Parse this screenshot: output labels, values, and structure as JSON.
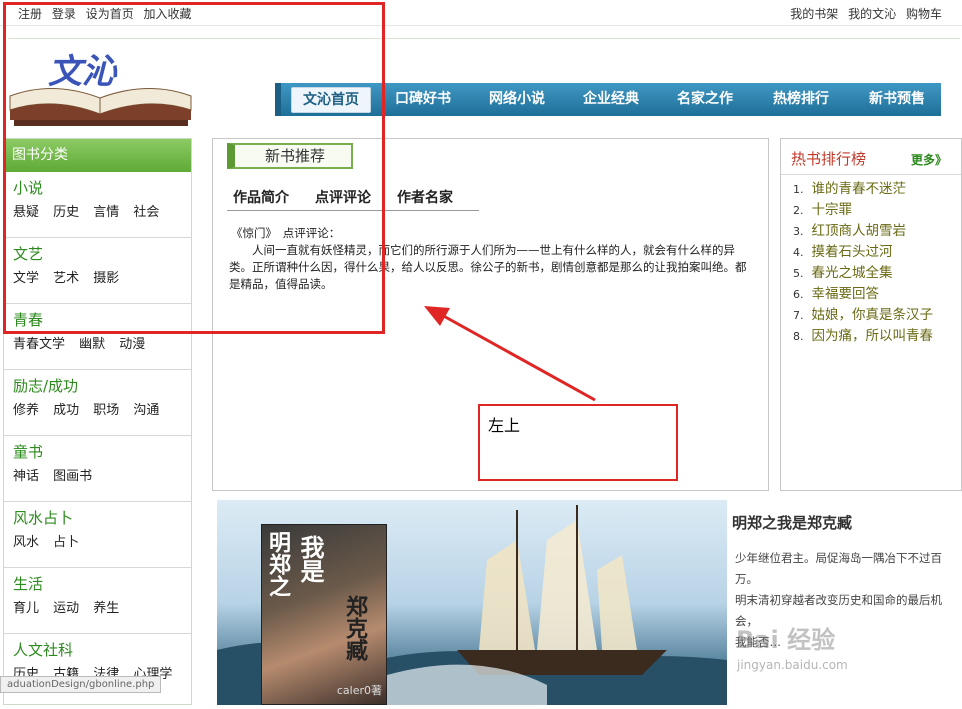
{
  "topbar": {
    "left": [
      "注册",
      "登录",
      "设为首页",
      "加入收藏"
    ],
    "right": [
      "我的书架",
      "我的文沁",
      "购物车"
    ]
  },
  "logo_text": "文沁",
  "nav": [
    "文沁首页",
    "口碑好书",
    "网络小说",
    "企业经典",
    "名家之作",
    "热榜排行",
    "新书预售"
  ],
  "sidebar": {
    "title": "图书分类",
    "categories": [
      {
        "title": "小说",
        "links": [
          "悬疑",
          "历史",
          "言情",
          "社会"
        ]
      },
      {
        "title": "文艺",
        "links": [
          "文学",
          "艺术",
          "摄影"
        ]
      },
      {
        "title": "青春",
        "links": [
          "青春文学",
          "幽默",
          "动漫"
        ]
      },
      {
        "title": "励志/成功",
        "links": [
          "修养",
          "成功",
          "职场",
          "沟通"
        ]
      },
      {
        "title": "童书",
        "links": [
          "神话",
          "图画书"
        ]
      },
      {
        "title": "风水占卜",
        "links": [
          "风水",
          "占卜"
        ]
      },
      {
        "title": "生活",
        "links": [
          "育儿",
          "运动",
          "养生"
        ]
      },
      {
        "title": "人文社科",
        "links": [
          "历史",
          "古籍",
          "法律",
          "心理学"
        ]
      }
    ]
  },
  "newbook": {
    "title": "新书推荐",
    "tabs": [
      "作品简介",
      "点评评论",
      "作者名家"
    ],
    "line1": "《惊门》　点评评论：",
    "text": "人间一直就有妖怪精灵，而它们的所行源于人们所为——世上有什么样的人，就会有什么样的异类。正所谓种什么因，得什么果，给人以反思。徐公子的新书，剧情创意都是那么的让我拍案叫绝。都是精品，值得品读。"
  },
  "hot": {
    "title": "热书排行榜",
    "more": "更多》",
    "items": [
      "谁的青春不迷茫",
      "十宗罪",
      "红顶商人胡雪岩",
      "摸着石头过河",
      "春光之城全集",
      "幸福要回答",
      "姑娘，你真是条汉子",
      "因为痛，所以叫青春"
    ]
  },
  "banner": {
    "cover_title_1": "明郑之",
    "cover_title_2": "我是",
    "cover_title_3": "郑克臧",
    "cover_author": "caler0著",
    "title": "明郑之我是郑克臧",
    "text": [
      "少年继位君主。局促海岛一隅冶下不过百万。",
      "明末清初穿越者改变历史和国命的最后机会，",
      "我能否…"
    ]
  },
  "status_url": "aduationDesign/gbonline.php",
  "watermark": "Bai 经验",
  "watermark_url": "jingyan.baidu.com",
  "annotation": {
    "label": "左上",
    "color": "#e02525"
  }
}
